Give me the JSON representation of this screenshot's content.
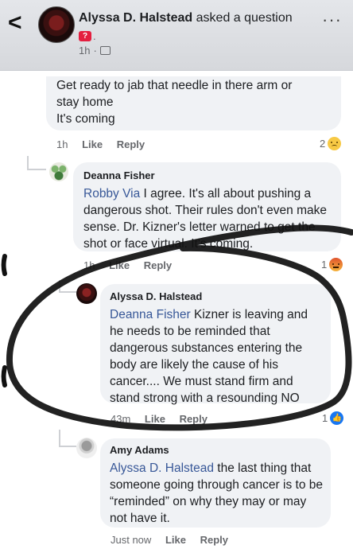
{
  "header": {
    "author": "Alyssa D. Halstead",
    "action": "asked a question",
    "dot": ".",
    "time": "1h",
    "separator": "·",
    "more": "···",
    "back": "<"
  },
  "comments": [
    {
      "text_lines": [
        "Get ready to jab that needle in there arm or",
        "stay home",
        "It's coming"
      ],
      "time": "1h",
      "like": "Like",
      "reply": "Reply",
      "reaction_count": "2",
      "reaction": "sad"
    },
    {
      "author": "Deanna Fisher",
      "mention": "Robby Via",
      "text": "I agree. It's all about pushing a dangerous shot. Their rules don't even make sense. Dr. Kizner's letter warned to get the shot or face virtual.  It's coming.",
      "time": "1h",
      "like": "Like",
      "reply": "Reply",
      "reaction_count": "1",
      "reaction": "angry"
    },
    {
      "author": "Alyssa D. Halstead",
      "mention": "Deanna Fisher",
      "text": "Kizner is leaving and he needs to be reminded that dangerous substances entering the body are likely the cause of his cancer.... We must stand firm and stand strong with a resounding NO",
      "time": "43m",
      "like": "Like",
      "reply": "Reply",
      "reaction_count": "1",
      "reaction": "like"
    },
    {
      "author": "Amy Adams",
      "mention": "Alyssa D. Halstead",
      "text": "the last thing that someone going through cancer is to be “reminded” on why they may or may not have it.",
      "time": "Just now",
      "like": "Like",
      "reply": "Reply"
    }
  ],
  "colors": {
    "mention": "#385898",
    "bubble": "#f0f2f5",
    "meta": "#65676b",
    "like_blue": "#1877f2"
  }
}
